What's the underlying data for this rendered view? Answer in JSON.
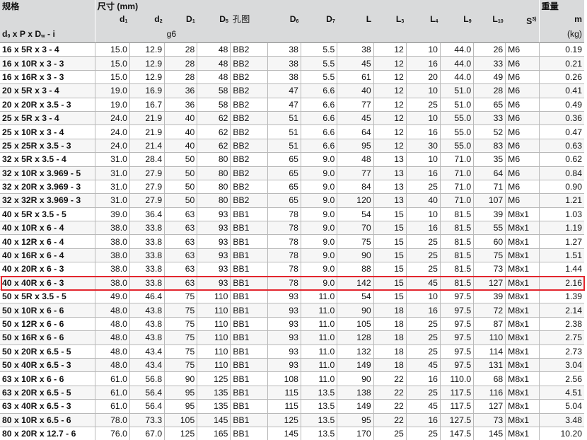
{
  "header": {
    "spec_label": "规格",
    "dimension_label": "尺寸 (mm)",
    "weight_label": "重量",
    "spec_formula": {
      "d": "d",
      "d_sub": "0",
      "mid": " x P x D",
      "w_sub": "w",
      "end": " - i"
    },
    "col_d1": {
      "base": "d",
      "sub": "1"
    },
    "col_d2": {
      "base": "d",
      "sub": "2"
    },
    "col_D1": {
      "base": "D",
      "sub": "1",
      "tol": "g6"
    },
    "col_D5": {
      "base": "D",
      "sub": "5"
    },
    "col_hole": "孔图",
    "col_D6": {
      "base": "D",
      "sub": "6"
    },
    "col_D7": {
      "base": "D",
      "sub": "7"
    },
    "col_L": "L",
    "col_L3": {
      "base": "L",
      "sub": "3"
    },
    "col_L4": {
      "base": "L",
      "sub": "4"
    },
    "col_L9": {
      "base": "L",
      "sub": "9"
    },
    "col_L10": {
      "base": "L",
      "sub": "10"
    },
    "col_S": {
      "base": "S",
      "sup": "3)"
    },
    "col_m": "m",
    "col_m_unit": "(kg)"
  },
  "rows": [
    [
      "16 x 5R x 3 - 4",
      "15.0",
      "12.9",
      "28",
      "48",
      "BB2",
      "38",
      "5.5",
      "38",
      "12",
      "10",
      "44.0",
      "26",
      "M6",
      "0.19"
    ],
    [
      "16 x 10R x 3 - 3",
      "15.0",
      "12.9",
      "28",
      "48",
      "BB2",
      "38",
      "5.5",
      "45",
      "12",
      "16",
      "44.0",
      "33",
      "M6",
      "0.21"
    ],
    [
      "16 x 16R x 3 - 3",
      "15.0",
      "12.9",
      "28",
      "48",
      "BB2",
      "38",
      "5.5",
      "61",
      "12",
      "20",
      "44.0",
      "49",
      "M6",
      "0.26"
    ],
    [
      "20 x 5R x 3 - 4",
      "19.0",
      "16.9",
      "36",
      "58",
      "BB2",
      "47",
      "6.6",
      "40",
      "12",
      "10",
      "51.0",
      "28",
      "M6",
      "0.41"
    ],
    [
      "20 x 20R x 3.5 - 3",
      "19.0",
      "16.7",
      "36",
      "58",
      "BB2",
      "47",
      "6.6",
      "77",
      "12",
      "25",
      "51.0",
      "65",
      "M6",
      "0.49"
    ],
    [
      "25 x 5R x 3 - 4",
      "24.0",
      "21.9",
      "40",
      "62",
      "BB2",
      "51",
      "6.6",
      "45",
      "12",
      "10",
      "55.0",
      "33",
      "M6",
      "0.36"
    ],
    [
      "25 x 10R x 3 - 4",
      "24.0",
      "21.9",
      "40",
      "62",
      "BB2",
      "51",
      "6.6",
      "64",
      "12",
      "16",
      "55.0",
      "52",
      "M6",
      "0.47"
    ],
    [
      "25 x 25R x 3.5 - 3",
      "24.0",
      "21.4",
      "40",
      "62",
      "BB2",
      "51",
      "6.6",
      "95",
      "12",
      "30",
      "55.0",
      "83",
      "M6",
      "0.63"
    ],
    [
      "32 x 5R x 3.5 - 4",
      "31.0",
      "28.4",
      "50",
      "80",
      "BB2",
      "65",
      "9.0",
      "48",
      "13",
      "10",
      "71.0",
      "35",
      "M6",
      "0.62"
    ],
    [
      "32 x 10R x 3.969 - 5",
      "31.0",
      "27.9",
      "50",
      "80",
      "BB2",
      "65",
      "9.0",
      "77",
      "13",
      "16",
      "71.0",
      "64",
      "M6",
      "0.84"
    ],
    [
      "32 x 20R x 3.969 - 3",
      "31.0",
      "27.9",
      "50",
      "80",
      "BB2",
      "65",
      "9.0",
      "84",
      "13",
      "25",
      "71.0",
      "71",
      "M6",
      "0.90"
    ],
    [
      "32 x 32R x 3.969 - 3",
      "31.0",
      "27.9",
      "50",
      "80",
      "BB2",
      "65",
      "9.0",
      "120",
      "13",
      "40",
      "71.0",
      "107",
      "M6",
      "1.21"
    ],
    [
      "40 x 5R x 3.5 - 5",
      "39.0",
      "36.4",
      "63",
      "93",
      "BB1",
      "78",
      "9.0",
      "54",
      "15",
      "10",
      "81.5",
      "39",
      "M8x1",
      "1.03"
    ],
    [
      "40 x 10R x 6 - 4",
      "38.0",
      "33.8",
      "63",
      "93",
      "BB1",
      "78",
      "9.0",
      "70",
      "15",
      "16",
      "81.5",
      "55",
      "M8x1",
      "1.19"
    ],
    [
      "40 x 12R x 6 - 4",
      "38.0",
      "33.8",
      "63",
      "93",
      "BB1",
      "78",
      "9.0",
      "75",
      "15",
      "25",
      "81.5",
      "60",
      "M8x1",
      "1.27"
    ],
    [
      "40 x 16R x 6 - 4",
      "38.0",
      "33.8",
      "63",
      "93",
      "BB1",
      "78",
      "9.0",
      "90",
      "15",
      "25",
      "81.5",
      "75",
      "M8x1",
      "1.51"
    ],
    [
      "40 x 20R x 6 - 3",
      "38.0",
      "33.8",
      "63",
      "93",
      "BB1",
      "78",
      "9.0",
      "88",
      "15",
      "25",
      "81.5",
      "73",
      "M8x1",
      "1.44"
    ],
    [
      "40 x 40R x 6 - 3",
      "38.0",
      "33.8",
      "63",
      "93",
      "BB1",
      "78",
      "9.0",
      "142",
      "15",
      "45",
      "81.5",
      "127",
      "M8x1",
      "2.16"
    ],
    [
      "50 x 5R x 3.5 - 5",
      "49.0",
      "46.4",
      "75",
      "110",
      "BB1",
      "93",
      "11.0",
      "54",
      "15",
      "10",
      "97.5",
      "39",
      "M8x1",
      "1.39"
    ],
    [
      "50 x 10R x 6 - 6",
      "48.0",
      "43.8",
      "75",
      "110",
      "BB1",
      "93",
      "11.0",
      "90",
      "18",
      "16",
      "97.5",
      "72",
      "M8x1",
      "2.14"
    ],
    [
      "50 x 12R x 6 - 6",
      "48.0",
      "43.8",
      "75",
      "110",
      "BB1",
      "93",
      "11.0",
      "105",
      "18",
      "25",
      "97.5",
      "87",
      "M8x1",
      "2.38"
    ],
    [
      "50 x 16R x 6 - 6",
      "48.0",
      "43.8",
      "75",
      "110",
      "BB1",
      "93",
      "11.0",
      "128",
      "18",
      "25",
      "97.5",
      "110",
      "M8x1",
      "2.75"
    ],
    [
      "50 x 20R x 6.5 - 5",
      "48.0",
      "43.4",
      "75",
      "110",
      "BB1",
      "93",
      "11.0",
      "132",
      "18",
      "25",
      "97.5",
      "114",
      "M8x1",
      "2.73"
    ],
    [
      "50 x 40R x 6.5 - 3",
      "48.0",
      "43.4",
      "75",
      "110",
      "BB1",
      "93",
      "11.0",
      "149",
      "18",
      "45",
      "97.5",
      "131",
      "M8x1",
      "3.04"
    ],
    [
      "63 x 10R x 6 - 6",
      "61.0",
      "56.8",
      "90",
      "125",
      "BB1",
      "108",
      "11.0",
      "90",
      "22",
      "16",
      "110.0",
      "68",
      "M8x1",
      "2.56"
    ],
    [
      "63 x 20R x 6.5 - 5",
      "61.0",
      "56.4",
      "95",
      "135",
      "BB1",
      "115",
      "13.5",
      "138",
      "22",
      "25",
      "117.5",
      "116",
      "M8x1",
      "4.51"
    ],
    [
      "63 x 40R x 6.5 - 3",
      "61.0",
      "56.4",
      "95",
      "135",
      "BB1",
      "115",
      "13.5",
      "149",
      "22",
      "45",
      "117.5",
      "127",
      "M8x1",
      "5.04"
    ],
    [
      "80 x 10R x 6.5 - 6",
      "78.0",
      "73.3",
      "105",
      "145",
      "BB1",
      "125",
      "13.5",
      "95",
      "22",
      "16",
      "127.5",
      "73",
      "M8x1",
      "3.48"
    ],
    [
      "80 x 20R x 12.7 - 6",
      "76.0",
      "67.0",
      "125",
      "165",
      "BB1",
      "145",
      "13.5",
      "170",
      "25",
      "25",
      "147.5",
      "145",
      "M8x1",
      "10.20"
    ]
  ],
  "highlight_row_index": 17,
  "colors": {
    "header_bg": "#d9dadb",
    "grid": "#b9b9b9",
    "highlight": "#e3262e"
  }
}
